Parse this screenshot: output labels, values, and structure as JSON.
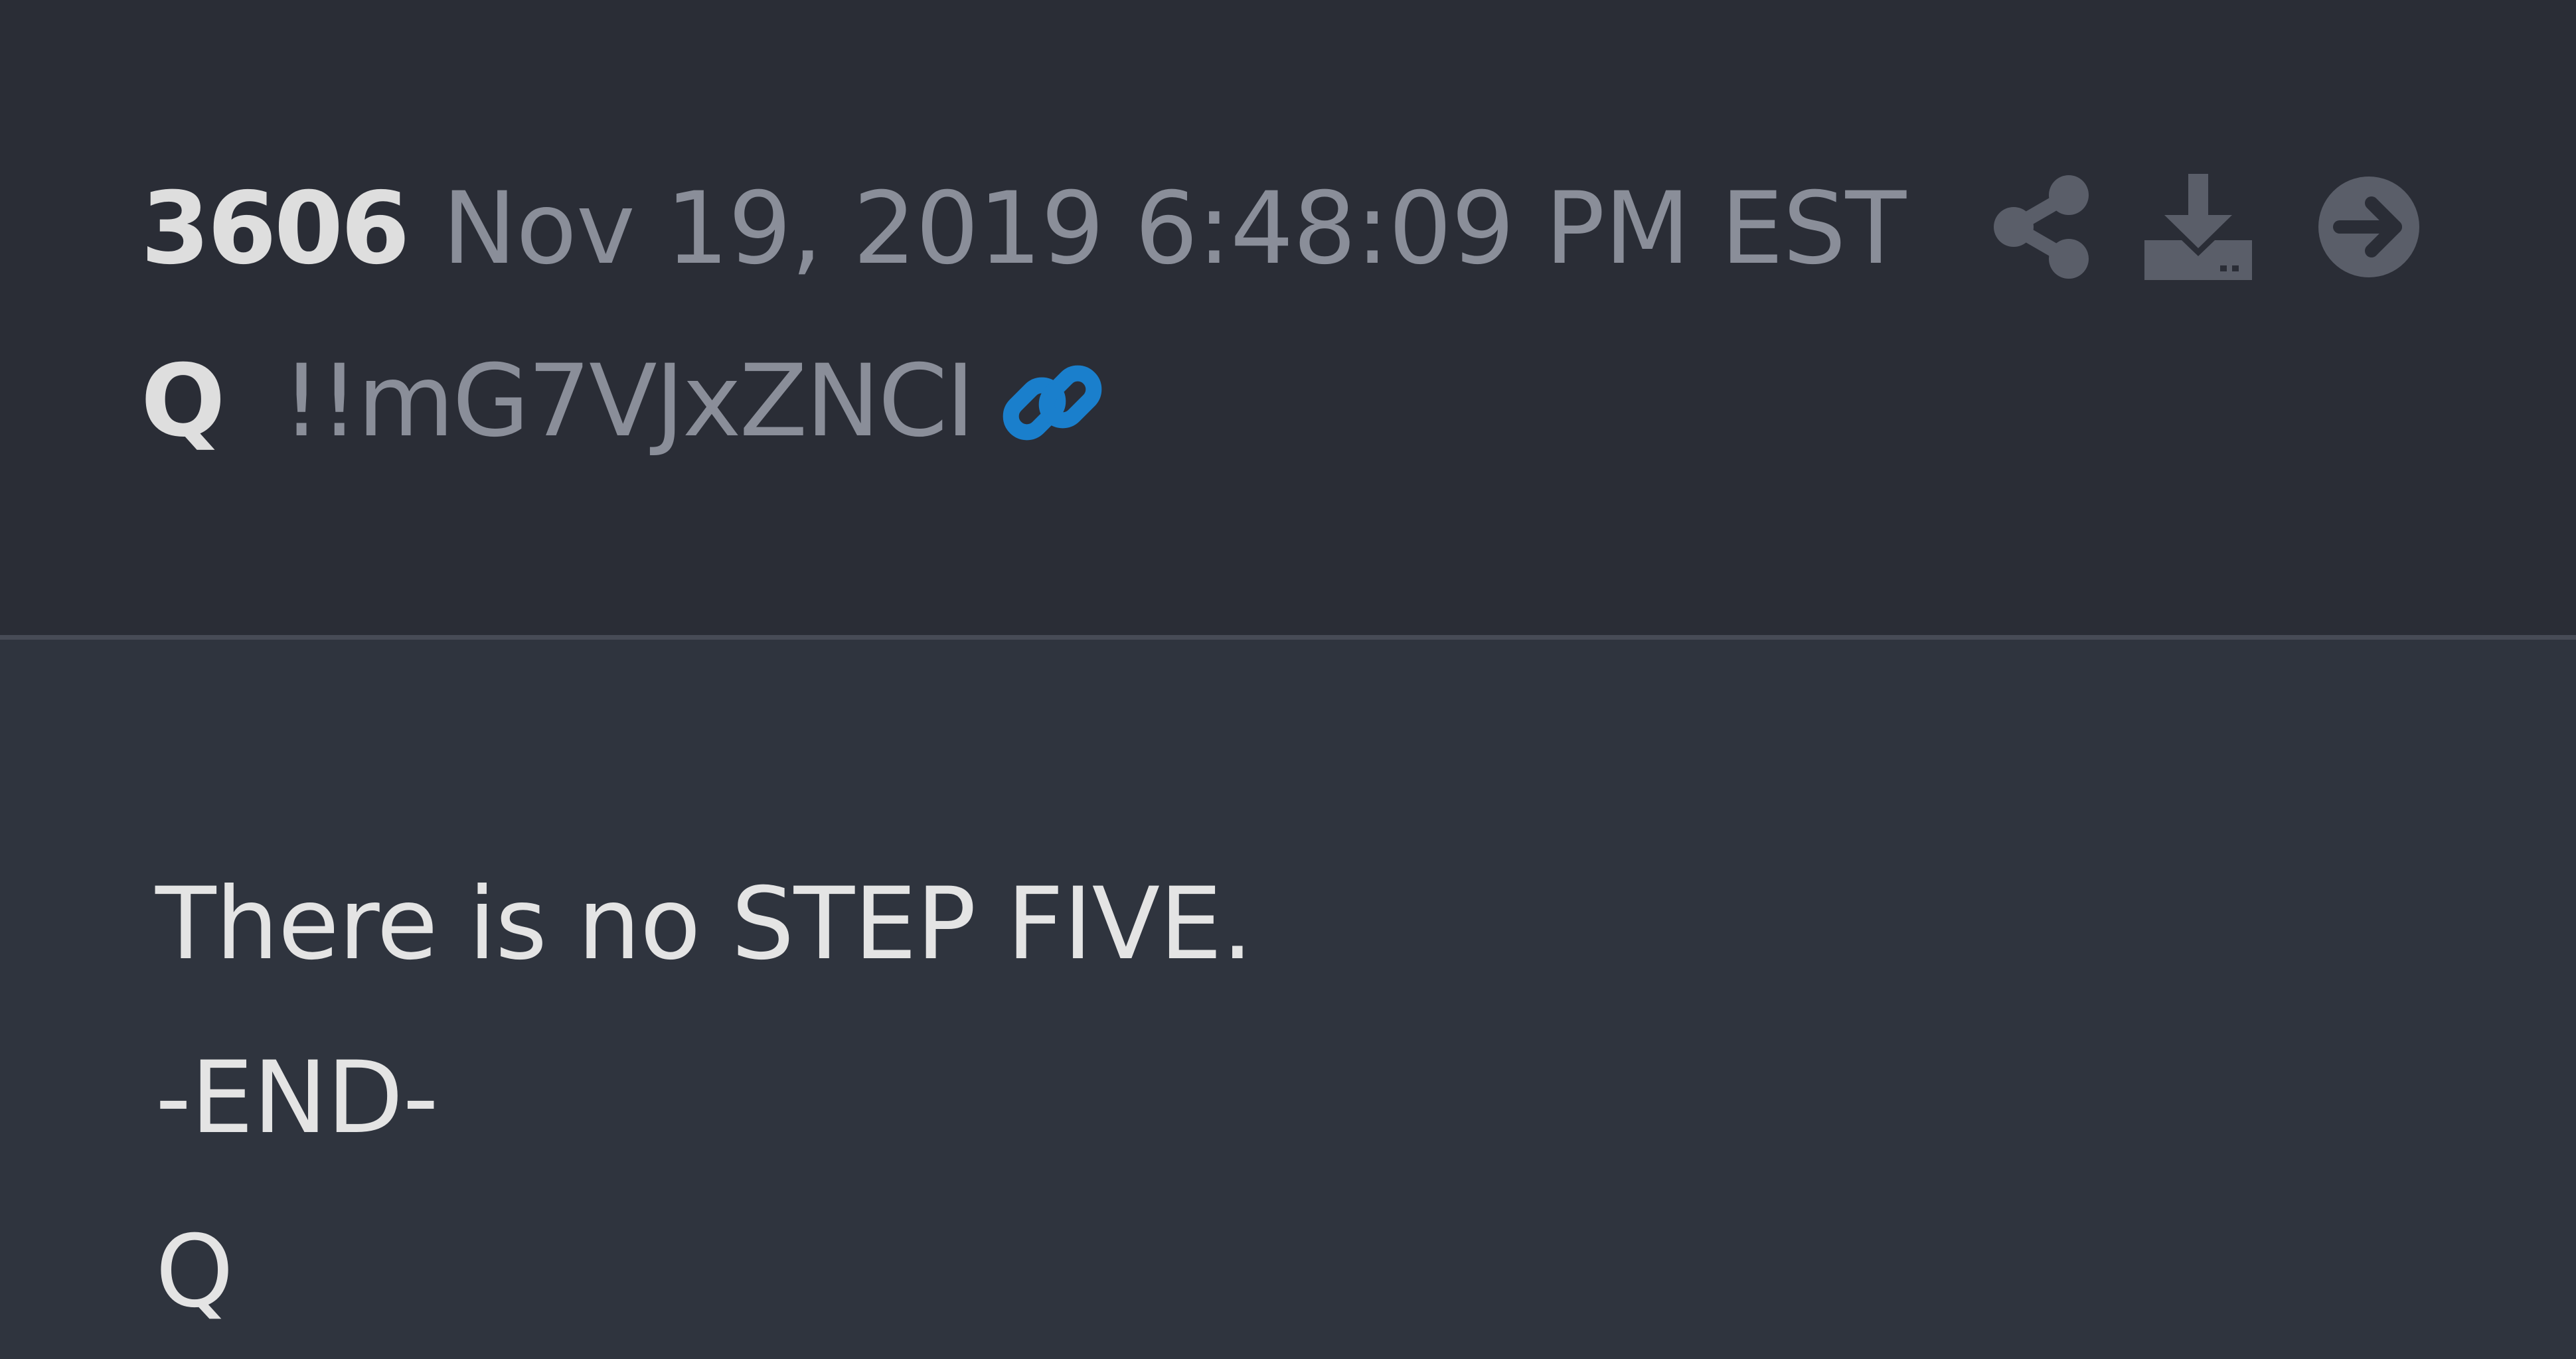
{
  "post": {
    "number": "3606",
    "timestamp": "Nov 19, 2019 6:48:09 PM EST",
    "author": "Q",
    "tripcode": "!!mG7VJxZNCI",
    "message_lines": [
      "There is no STEP FIVE.",
      "-END-",
      "Q"
    ]
  },
  "icons": {
    "link": "link-icon",
    "share": "share-icon",
    "download": "download-icon",
    "next": "arrow-right-circle-icon"
  },
  "colors": {
    "header_bg": "#2a2d36",
    "body_bg": "#2f343e",
    "divider": "#474b56",
    "muted_text": "#8a8e99",
    "bright_text": "#dedede",
    "link_blue": "#1a7fcc",
    "icon_gray": "#5a5e69"
  }
}
